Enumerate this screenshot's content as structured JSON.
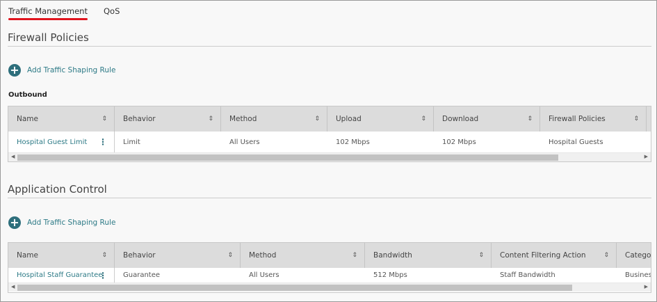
{
  "tabs": [
    {
      "label": "Traffic Management",
      "active": true
    },
    {
      "label": "QoS",
      "active": false
    }
  ],
  "firewall": {
    "title": "Firewall Policies",
    "add_label": "Add Traffic Shaping Rule",
    "subtitle": "Outbound",
    "columns": [
      "Name",
      "Behavior",
      "Method",
      "Upload",
      "Download",
      "Firewall Policies"
    ],
    "rows": [
      [
        "Hospital Guest Limit",
        "Limit",
        "All Users",
        "102 Mbps",
        "102 Mbps",
        "Hospital Guests"
      ]
    ]
  },
  "appcontrol": {
    "title": "Application Control",
    "add_label": "Add Traffic Shaping Rule",
    "columns": [
      "Name",
      "Behavior",
      "Method",
      "Bandwidth",
      "Content Filtering Action",
      "Categori"
    ],
    "rows": [
      [
        "Hospital Staff Guarantee",
        "Guarantee",
        "All Users",
        "512 Mbps",
        "Staff Bandwidth",
        "Business"
      ]
    ]
  },
  "icons": {
    "add": "plus-circle-icon",
    "sort": "sort-icon",
    "menu": "kebab-menu-icon"
  },
  "colors": {
    "accent": "#2e6f7c",
    "tab_underline": "#e0141e"
  }
}
